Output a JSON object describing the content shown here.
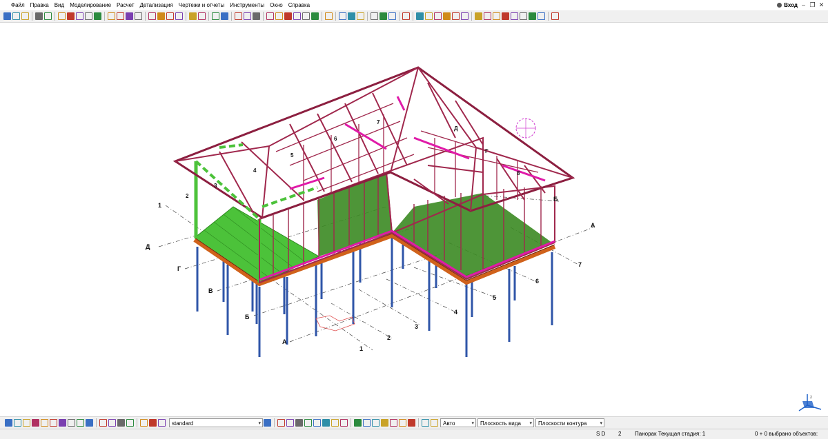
{
  "menu": {
    "items": [
      "Файл",
      "Правка",
      "Вид",
      "Моделирование",
      "Расчет",
      "Детализация",
      "Чертежи и отчеты",
      "Инструменты",
      "Окно",
      "Справка"
    ],
    "login_label": "Вход"
  },
  "window_controls": {
    "minimize": "–",
    "restore": "❐",
    "close": "✕"
  },
  "bottom_toolbar": {
    "standard_select": "standard",
    "auto_select": "Авто",
    "view_plane_select": "Плоскость вида",
    "contour_plane_select": "Плоскости контура"
  },
  "status": {
    "mode": "S D",
    "number": "2",
    "message": "Панорак Текущая стадия: 1",
    "selected": "0 + 0 выбрано объектов:"
  },
  "grid_labels": {
    "letters_left": [
      "Д",
      "Г",
      "В",
      "Б",
      "А"
    ],
    "numbers_front": [
      "1",
      "2",
      "3",
      "4",
      "5",
      "6",
      "7"
    ],
    "right_letters": [
      "А",
      "Б"
    ],
    "number_left": "1",
    "roof_labels": [
      "2",
      "3",
      "4",
      "5",
      "6",
      "7",
      "8",
      "Д",
      "Г",
      "Б"
    ]
  },
  "colors": {
    "frame": "#a0284d",
    "frame_dark": "#6e1530",
    "magenta": "#e01aa8",
    "green_deck": "#4cc23a",
    "green_floor": "#3b8a22",
    "beam": "#d0621b",
    "column": "#2f55a8",
    "gridline": "#444444",
    "view_cube": "#1f62c9"
  },
  "icons": [
    "new-icon",
    "open-icon",
    "save-icon",
    "undo-icon",
    "redo-icon",
    "print-icon",
    "select-icon",
    "zoom-icon",
    "view-cube-icon"
  ]
}
